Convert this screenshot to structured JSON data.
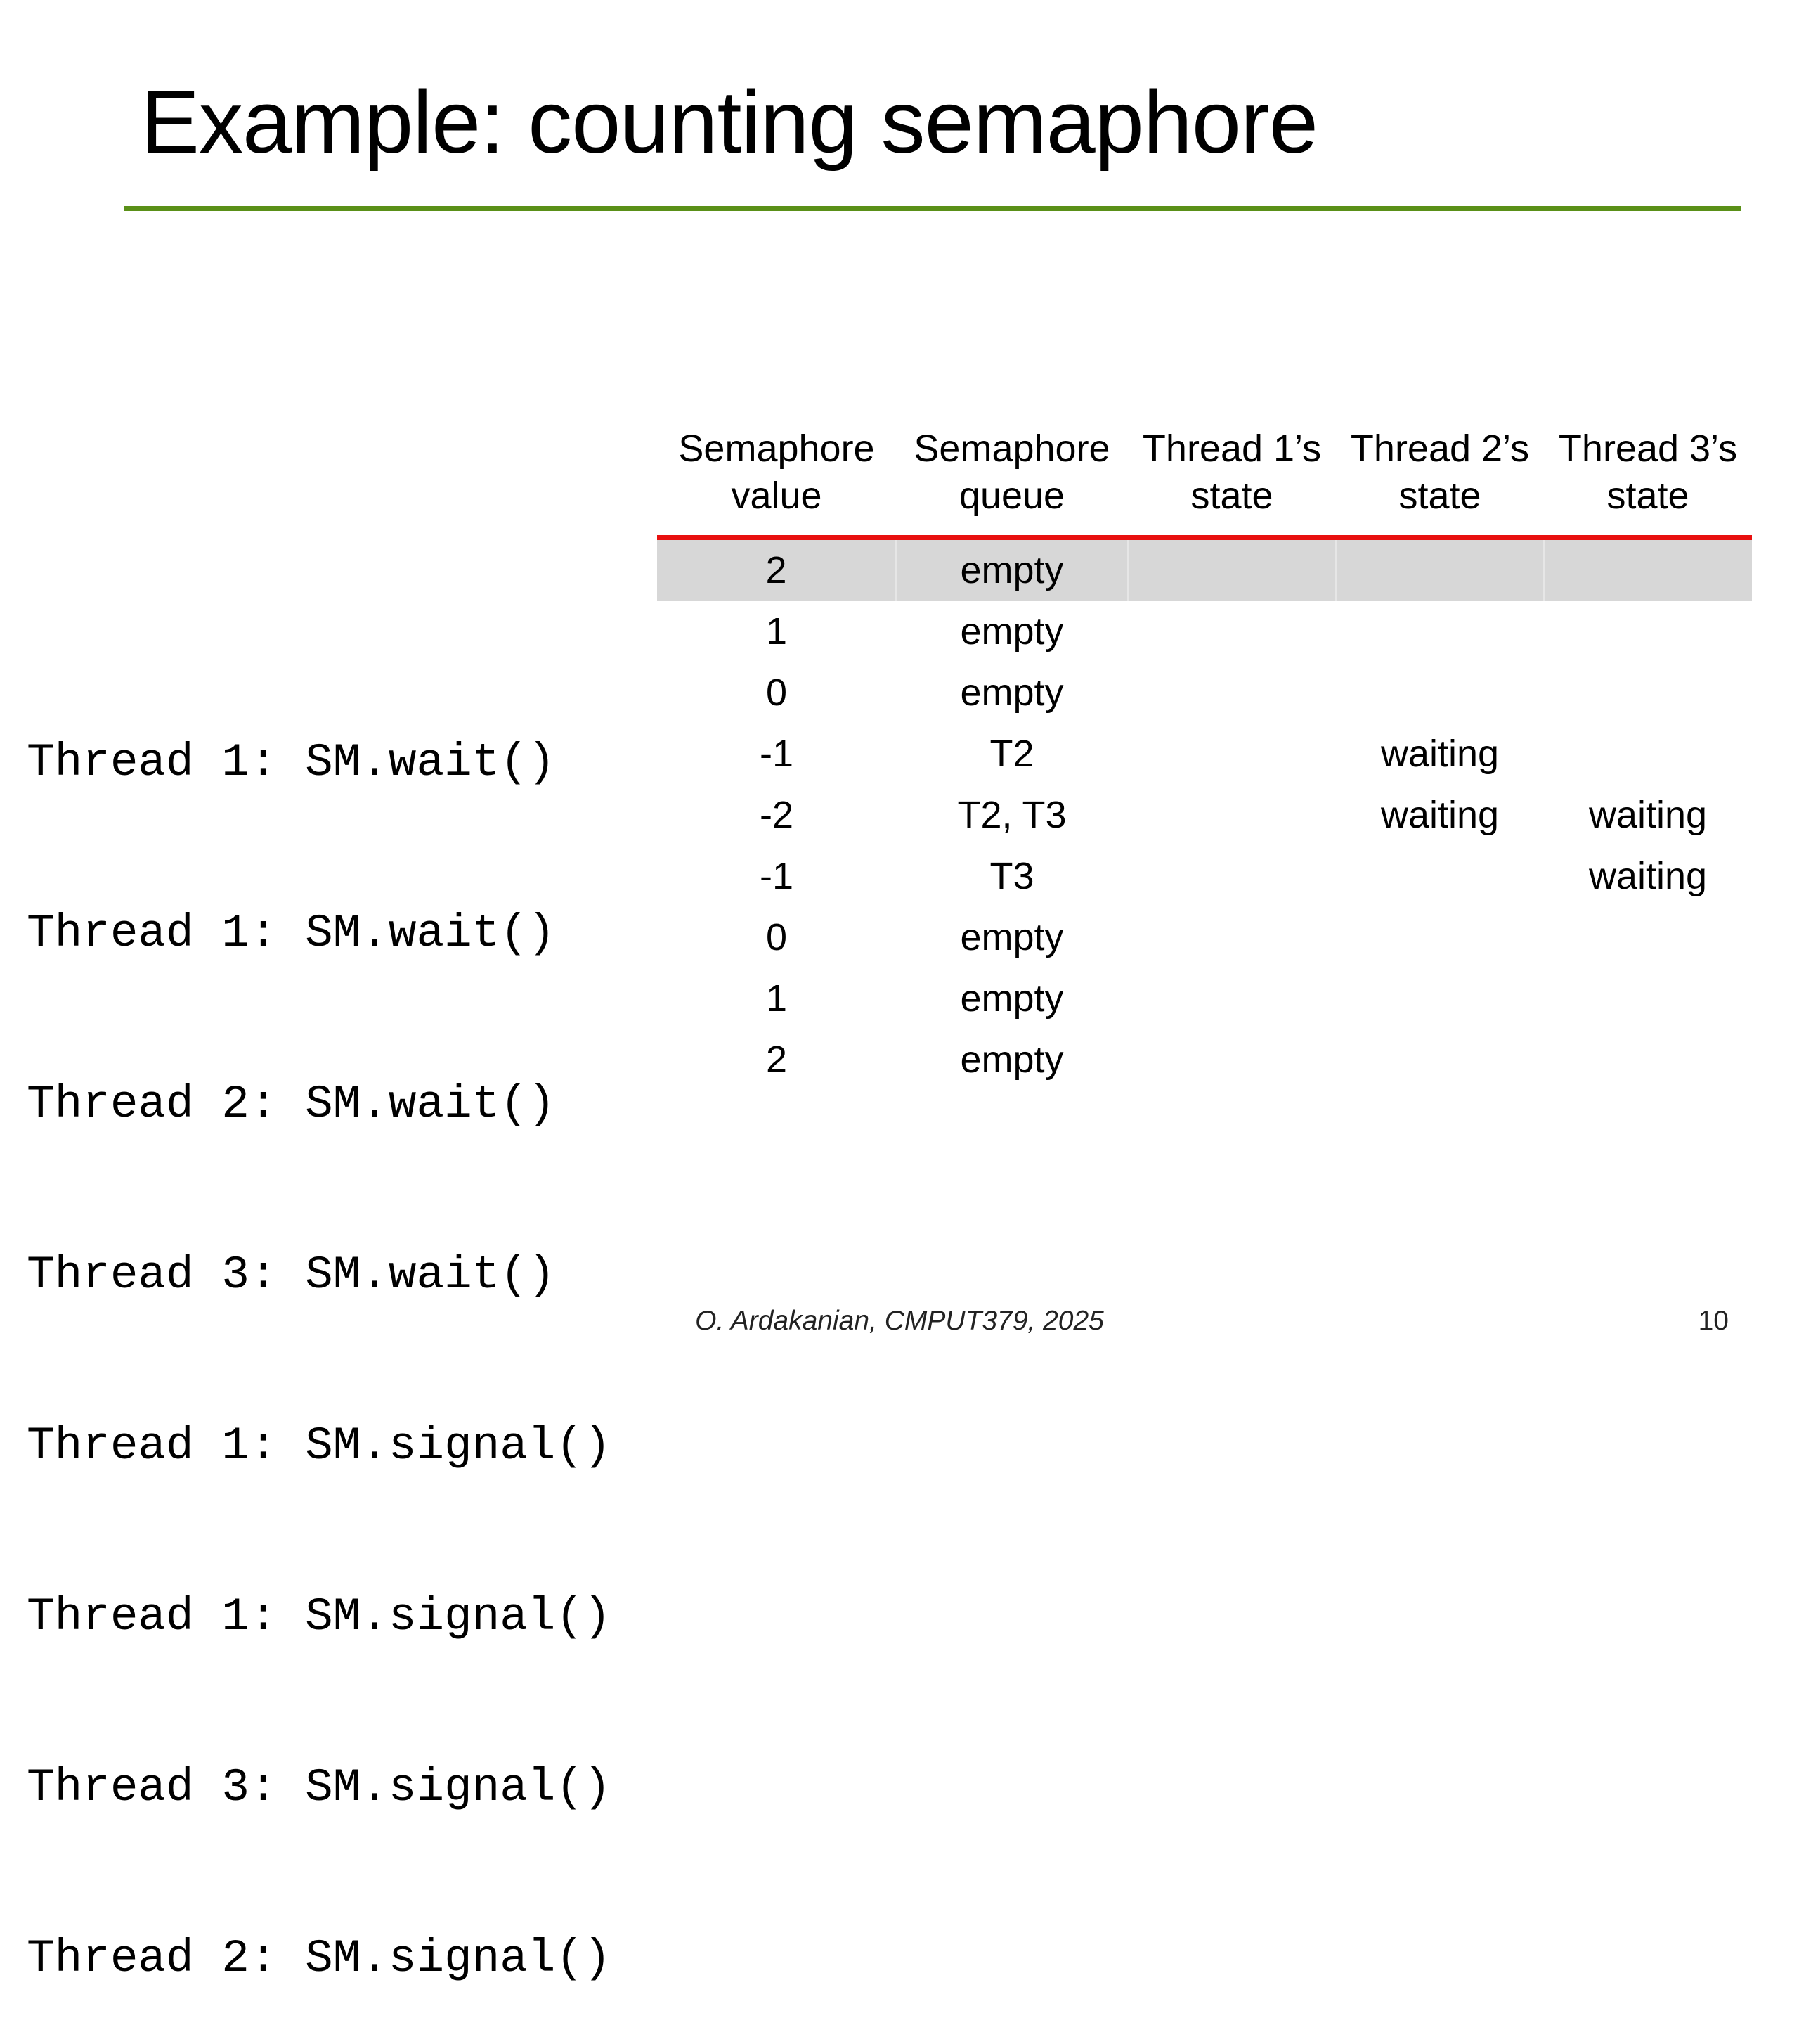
{
  "slide": {
    "title": "Example: counting semaphore",
    "footer": "O. Ardakanian, CMPUT379, 2025",
    "page_number": "10"
  },
  "code_lines": [
    "Thread 1: SM.wait()",
    "Thread 1: SM.wait()",
    "Thread 2: SM.wait()",
    "Thread 3: SM.wait()",
    "Thread 1: SM.signal()",
    "Thread 1: SM.signal()",
    "Thread 3: SM.signal()",
    "Thread 2: SM.signal()"
  ],
  "table": {
    "headers": [
      [
        "Semaphore",
        "value"
      ],
      [
        "Semaphore",
        "queue"
      ],
      [
        "Thread 1’s",
        "state"
      ],
      [
        "Thread 2’s",
        "state"
      ],
      [
        "Thread 3’s",
        "state"
      ]
    ],
    "rows": [
      [
        "2",
        "empty",
        "",
        "",
        ""
      ],
      [
        "1",
        "empty",
        "",
        "",
        ""
      ],
      [
        "0",
        "empty",
        "",
        "",
        ""
      ],
      [
        "-1",
        "T2",
        "",
        "waiting",
        ""
      ],
      [
        "-2",
        "T2, T3",
        "",
        "waiting",
        "waiting"
      ],
      [
        "-1",
        "T3",
        "",
        "",
        "waiting"
      ],
      [
        "0",
        "empty",
        "",
        "",
        ""
      ],
      [
        "1",
        "empty",
        "",
        "",
        ""
      ],
      [
        "2",
        "empty",
        "",
        "",
        ""
      ]
    ],
    "highlighted_row": 0
  },
  "colors": {
    "title_rule": "#5a9018",
    "header_rule": "#e8100f",
    "highlight_row": "#d7d7d7"
  }
}
